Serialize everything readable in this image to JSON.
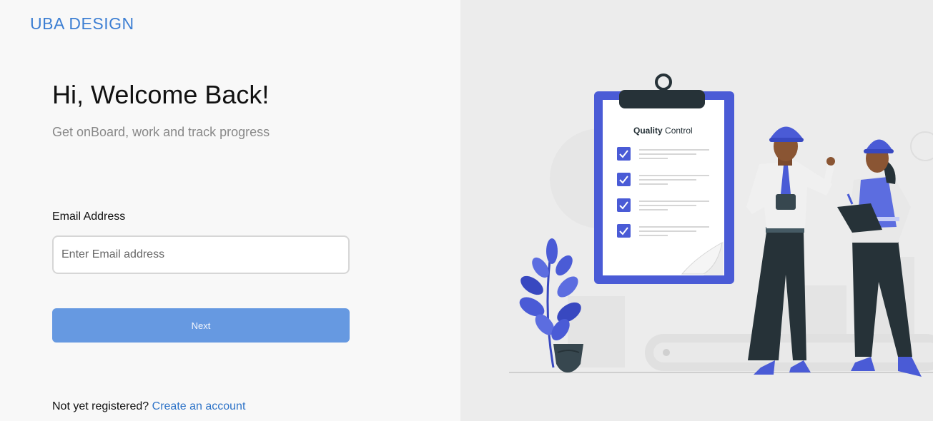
{
  "brand": {
    "name": "UBA DESIGN"
  },
  "login": {
    "title": "Hi, Welcome Back!",
    "subtitle": "Get onBoard, work and track progress",
    "email_label": "Email Address",
    "email_placeholder": "Enter Email address",
    "email_value": "",
    "next_label": "Next",
    "register_prompt": "Not yet registered?",
    "register_link": "Create an account"
  },
  "illustration": {
    "clipboard_title_bold": "Quality",
    "clipboard_title_rest": " Control",
    "checked_items": 4
  },
  "colors": {
    "brand": "#3d7fd3",
    "button": "#6699e1",
    "link": "#2f74c8",
    "illustration_accent": "#4a5bd6"
  }
}
